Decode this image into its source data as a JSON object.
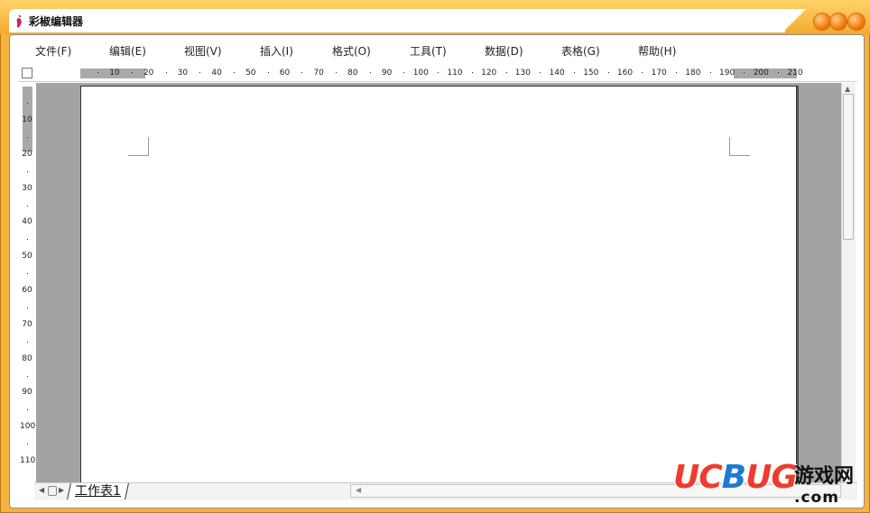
{
  "window": {
    "title": "彩椒编辑器"
  },
  "menu": [
    {
      "label": "文件(F)"
    },
    {
      "label": "编辑(E)"
    },
    {
      "label": "视图(V)"
    },
    {
      "label": "插入(I)"
    },
    {
      "label": "格式(O)"
    },
    {
      "label": "工具(T)"
    },
    {
      "label": "数据(D)"
    },
    {
      "label": "表格(G)"
    },
    {
      "label": "帮助(H)"
    }
  ],
  "ruler": {
    "horizontal_labels": [
      "10",
      "20",
      "30",
      "40",
      "50",
      "60",
      "70",
      "80",
      "90",
      "100",
      "110",
      "120",
      "130",
      "140",
      "150",
      "160",
      "170",
      "180",
      "190",
      "200",
      "210"
    ],
    "vertical_labels": [
      "10",
      "20",
      "30",
      "40",
      "50",
      "60",
      "70",
      "80",
      "90",
      "100",
      "110"
    ]
  },
  "sheet_tabs": [
    {
      "label": "工作表1"
    }
  ],
  "watermark": {
    "brand_red_1": "UC",
    "brand_blue": "B",
    "brand_red_2": "UG",
    "brand_cn": "游戏网",
    "brand_domain": ".com"
  },
  "colors": {
    "frame": "#f6b23c",
    "window_control": "#f37a10",
    "canvas": "#a3a3a3",
    "watermark_red": "#ef3b2d",
    "watermark_blue": "#1f7ad1"
  },
  "icons": {
    "app": "pepper-icon",
    "controls": [
      "minimize-icon",
      "maximize-icon",
      "close-icon"
    ]
  }
}
